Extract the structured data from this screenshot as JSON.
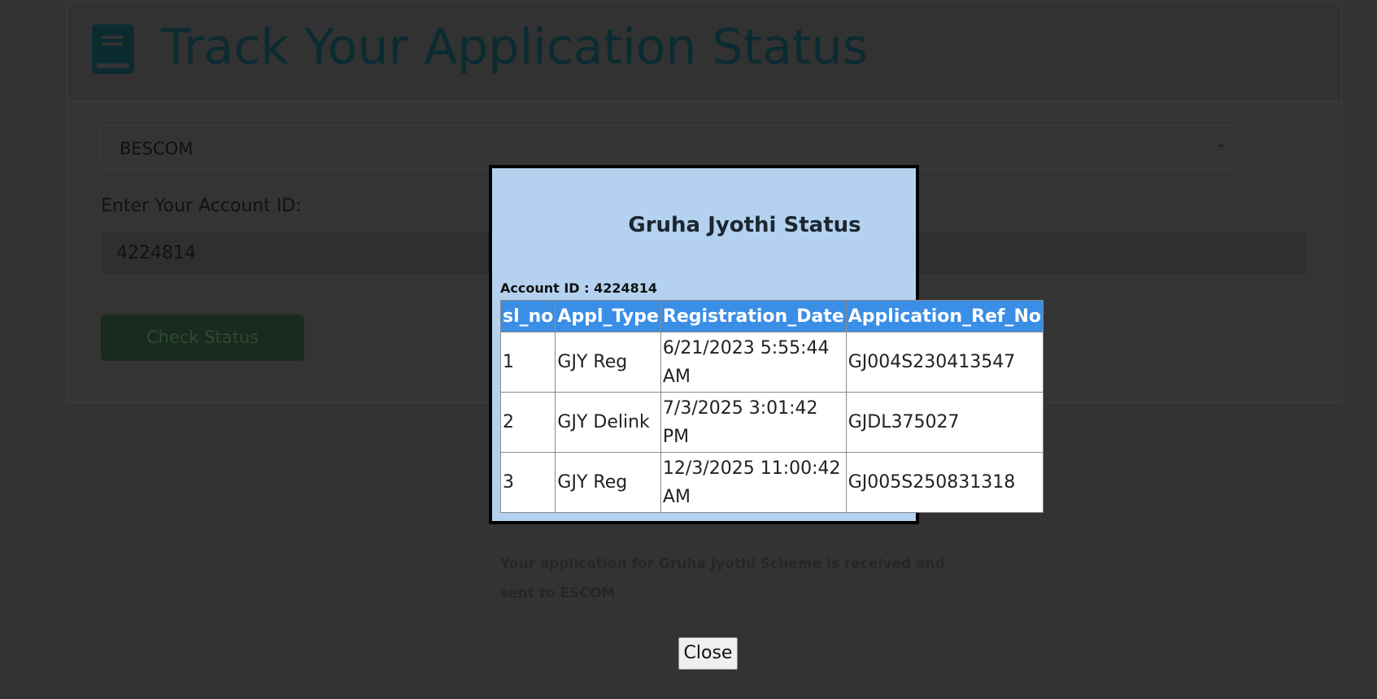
{
  "page": {
    "title": "Track Your Application Status",
    "escom_select": "BESCOM",
    "account_label": "Enter Your Account ID:",
    "account_value": "4224814",
    "check_button": "Check Status"
  },
  "modal": {
    "title": "Gruha Jyothi Status",
    "account_line": "Account ID : 4224814",
    "columns": [
      "sl_no",
      "Appl_Type",
      "Registration_Date",
      "Application_Ref_No"
    ],
    "rows": [
      [
        "1",
        "GJY Reg",
        "6/21/2023 5:55:44 AM",
        "GJ004S230413547"
      ],
      [
        "2",
        "GJY Delink",
        "7/3/2025 3:01:42 PM",
        "GJDL375027"
      ],
      [
        "3",
        "GJY Reg",
        "12/3/2025 11:00:42 AM",
        "GJ005S250831318"
      ]
    ],
    "message": "Your application for Gruha Jyothi Scheme is received and sent to ESCOM",
    "close_label": "Close"
  },
  "colors": {
    "modal_bg": "#b4d2ef",
    "header_bg": "#3a8ee6",
    "title": "#0b2b31"
  }
}
